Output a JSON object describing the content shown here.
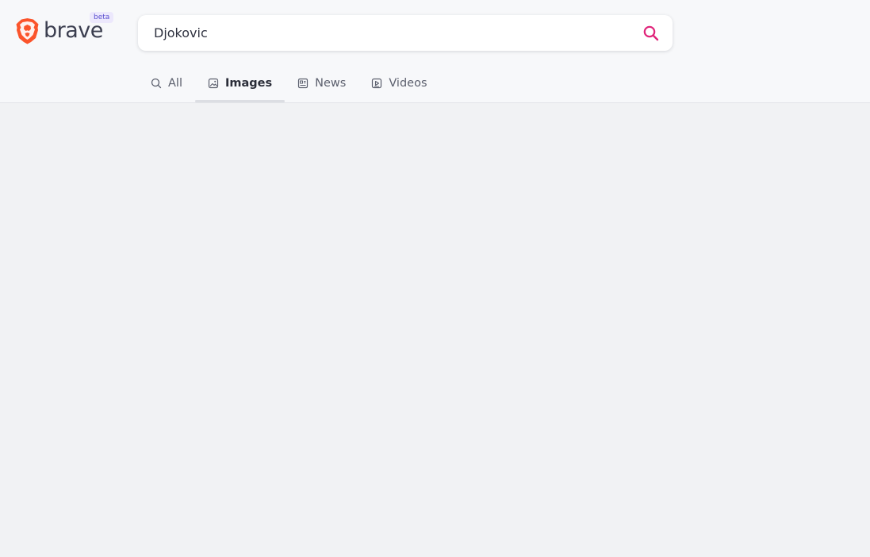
{
  "brand": {
    "name": "brave",
    "badge": "beta"
  },
  "search": {
    "query": "Djokovic",
    "placeholder": "",
    "submit_icon": "search-icon",
    "accent_color": "#e0247a"
  },
  "tabs": [
    {
      "label": "All",
      "icon": "search-icon",
      "active": false
    },
    {
      "label": "Images",
      "icon": "image-icon",
      "active": true
    },
    {
      "label": "News",
      "icon": "news-icon",
      "active": false
    },
    {
      "label": "Videos",
      "icon": "video-icon",
      "active": false
    }
  ],
  "colors": {
    "logo": "#fb542b",
    "badge_bg": "#ece8fc",
    "badge_text": "#5a4fcf"
  }
}
